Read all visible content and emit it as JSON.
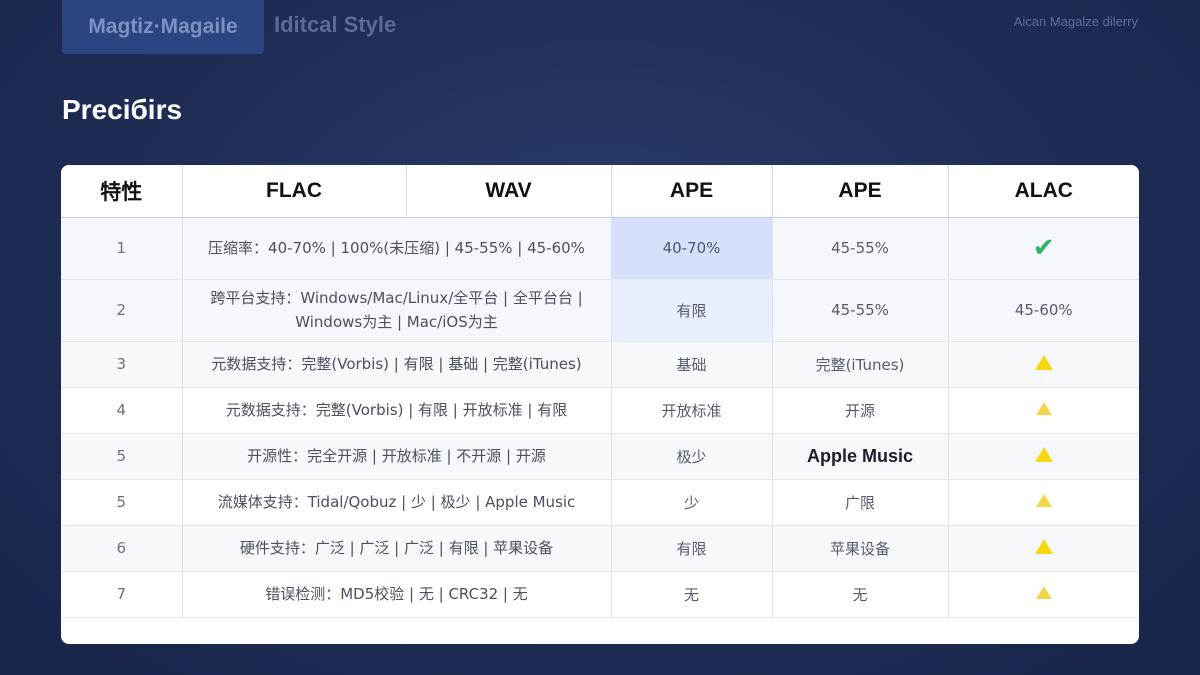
{
  "topbar": {
    "active_tab": "Magtiz·Magaile",
    "second_tab": "Iditcal Style",
    "right_text": "Aican Magalze dilerry"
  },
  "page_title": "Preciбirs",
  "table": {
    "headers": [
      "特性",
      "FLAC",
      "WAV",
      "APE",
      "APE",
      "ALAC"
    ],
    "rows": [
      {
        "num": "1",
        "feature": "压缩率：40-70% | 100%(未压缩) | 45-55% | 45-60%",
        "ape1": "40-70%",
        "ape2": "45-55%",
        "alac": "",
        "alac_icon": "check-icon"
      },
      {
        "num": "2",
        "feature": "跨平台支持：Windows/Mac/Linux/全平台 | 全平台台 | Windows为主 | Mac/iOS为主",
        "ape1": "有限",
        "ape2": "45-55%",
        "alac": "45-60%",
        "alac_icon": ""
      },
      {
        "num": "3",
        "feature": "元数据支持：完整(Vorbis) | 有限 | 基础 | 完整(iTunes)",
        "ape1": "基础",
        "ape2": "完整(iTunes)",
        "alac": "",
        "alac_icon": "warning-triangle-icon"
      },
      {
        "num": "4",
        "feature": "元数据支持：完整(Vorbis) | 有限 | 开放标准 | 有限",
        "ape1": "开放标准",
        "ape2": "开源",
        "alac": "",
        "alac_icon": "warning-triangle-icon"
      },
      {
        "num": "5",
        "feature": "开源性：完全开源 | 开放标准 | 不开源 | 开源",
        "ape1": "极少",
        "ape2": "Apple Music",
        "alac": "",
        "alac_icon": "warning-triangle-icon"
      },
      {
        "num": "5",
        "feature": "流媒体支持：Tidal/Qobuz | 少 | 极少 | Apple Music",
        "ape1": "少",
        "ape2": "广限",
        "alac": "",
        "alac_icon": "warning-triangle-icon"
      },
      {
        "num": "6",
        "feature": "硬件支持：广泛 | 广泛 | 广泛 | 有限 | 苹果设备",
        "ape1": "有限",
        "ape2": "苹果设备",
        "alac": "",
        "alac_icon": "warning-triangle-icon"
      },
      {
        "num": "7",
        "feature": "错误检测：MD5校验 | 无 | CRC32 | 无",
        "ape1": "无",
        "ape2": "无",
        "alac": "",
        "alac_icon": "warning-triangle-icon"
      }
    ]
  },
  "colors": {
    "background": "#1f2d55",
    "check": "#28b463",
    "warning": "#f5d80f",
    "highlight": "#d6e0fb"
  }
}
